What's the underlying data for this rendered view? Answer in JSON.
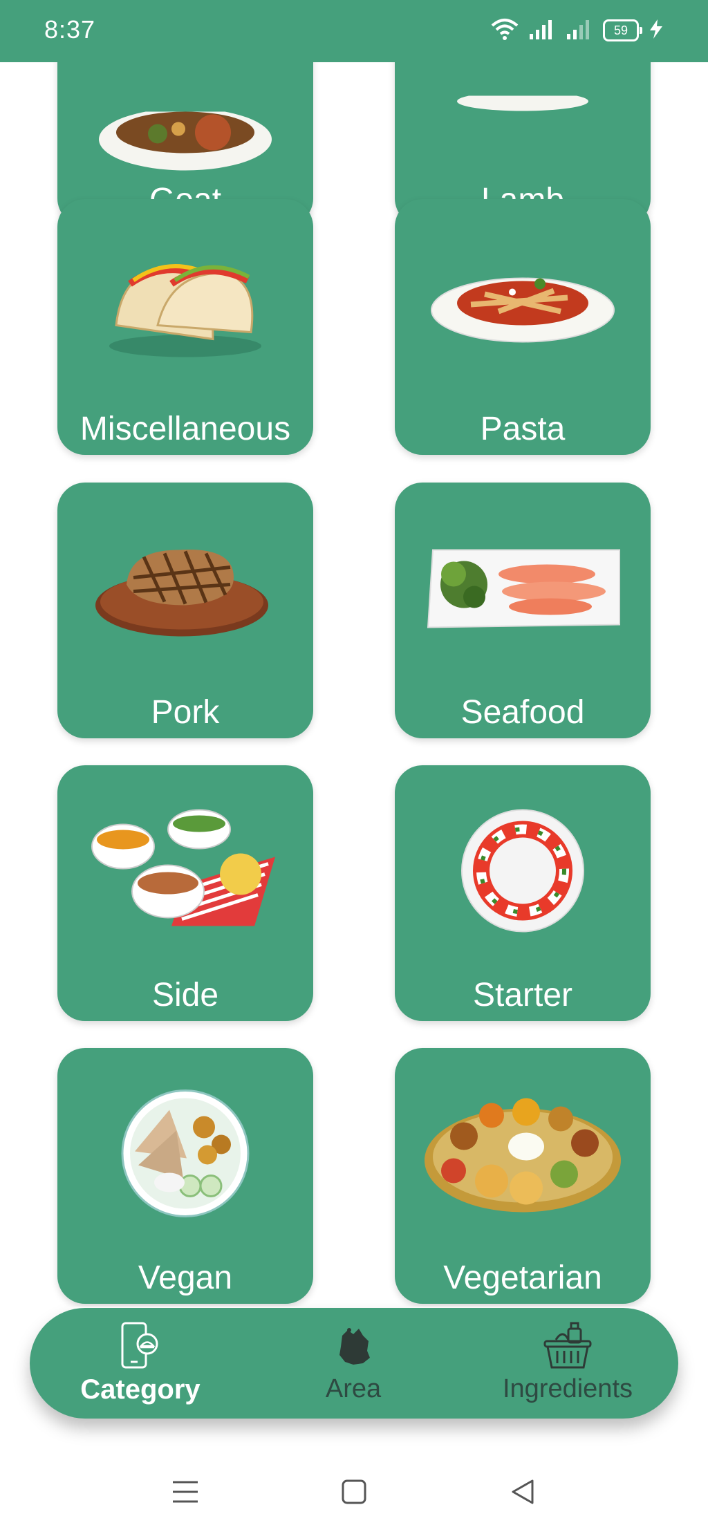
{
  "status_bar": {
    "time": "8:37",
    "battery": "59",
    "icons": [
      "wifi-icon",
      "signal-icon",
      "signal-weak-icon",
      "battery-icon",
      "charging-icon"
    ],
    "bg_color": "#45a07c"
  },
  "categories": [
    {
      "label": "Goat",
      "icon": "goat-dish-image"
    },
    {
      "label": "Lamb",
      "icon": "lamb-dish-image"
    },
    {
      "label": "Miscellaneous",
      "icon": "tacos-image"
    },
    {
      "label": "Pasta",
      "icon": "pasta-image"
    },
    {
      "label": "Pork",
      "icon": "pork-steak-image"
    },
    {
      "label": "Seafood",
      "icon": "salmon-plate-image"
    },
    {
      "label": "Side",
      "icon": "side-dishes-image"
    },
    {
      "label": "Starter",
      "icon": "caprese-image"
    },
    {
      "label": "Vegan",
      "icon": "vegan-bowl-image"
    },
    {
      "label": "Vegetarian",
      "icon": "thali-image"
    }
  ],
  "bottom_nav": {
    "items": [
      {
        "label": "Category",
        "icon": "phone-dish-icon",
        "active": true
      },
      {
        "label": "Area",
        "icon": "map-region-icon",
        "active": false
      },
      {
        "label": "Ingredients",
        "icon": "basket-icon",
        "active": false
      }
    ],
    "accent": "#45a07c",
    "inactive_color": "#2e4a42",
    "active_color": "#ffffff"
  },
  "system_nav": {
    "icons": [
      "menu-icon",
      "home-icon",
      "back-icon"
    ]
  }
}
